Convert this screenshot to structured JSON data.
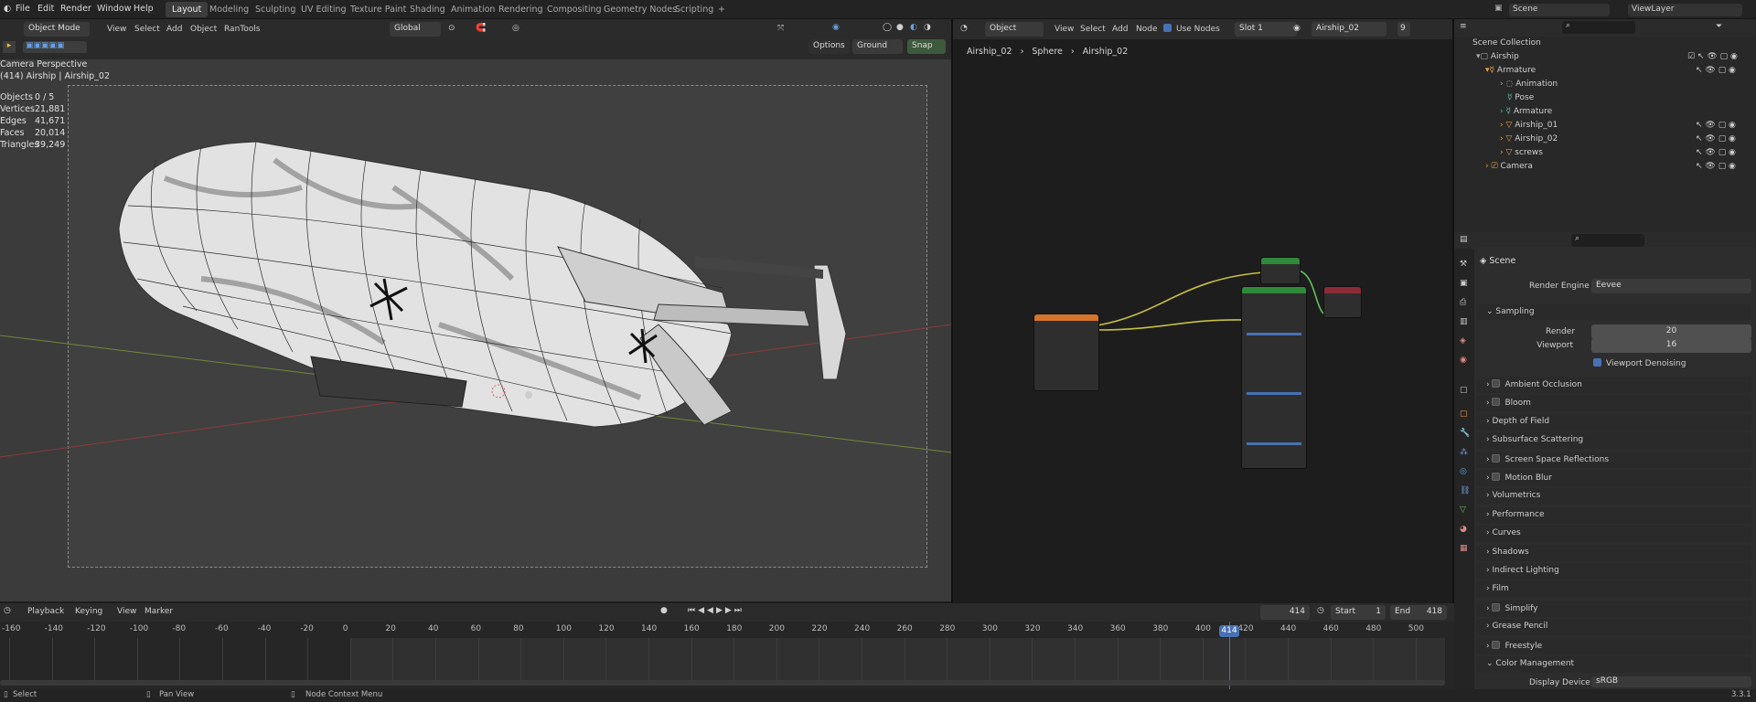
{
  "topbar": {
    "menus": [
      "File",
      "Edit",
      "Render",
      "Window",
      "Help"
    ],
    "workspaces": [
      "Layout",
      "Modeling",
      "Sculpting",
      "UV Editing",
      "Texture Paint",
      "Shading",
      "Animation",
      "Rendering",
      "Compositing",
      "Geometry Nodes",
      "Scripting"
    ],
    "active_workspace": "Layout",
    "add_tab": "+",
    "scene": "Scene",
    "view_layer": "ViewLayer"
  },
  "viewport_header": {
    "mode": "Object Mode",
    "menus": [
      "View",
      "Select",
      "Add",
      "Object",
      "RanTools"
    ],
    "orientation": "Global",
    "options": "Options",
    "ground": "Ground",
    "snap": "Snap"
  },
  "viewport": {
    "camera_label": "Camera Perspective",
    "object_label": "(414) Airship | Airship_02",
    "stats": [
      {
        "k": "Objects",
        "v": "0 / 5"
      },
      {
        "k": "Vertices",
        "v": "21,881"
      },
      {
        "k": "Edges",
        "v": "41,671"
      },
      {
        "k": "Faces",
        "v": "20,014"
      },
      {
        "k": "Triangles",
        "v": "39,249"
      }
    ]
  },
  "node_editor": {
    "type": "Object",
    "menus": [
      "View",
      "Select",
      "Add",
      "Node"
    ],
    "use_nodes": "Use Nodes",
    "slot": "Slot 1",
    "material": "Airship_02",
    "users": "9",
    "breadcrumb": [
      "Airship_02",
      "Sphere",
      "Airship_02"
    ]
  },
  "outliner": {
    "root": "Scene Collection",
    "items": [
      {
        "label": "Airship",
        "indent": 0
      },
      {
        "label": "Armature",
        "indent": 1
      },
      {
        "label": "Animation",
        "indent": 2
      },
      {
        "label": "Pose",
        "indent": 2
      },
      {
        "label": "Armature",
        "indent": 2
      },
      {
        "label": "Airship_01",
        "indent": 2
      },
      {
        "label": "Airship_02",
        "indent": 2
      },
      {
        "label": "screws",
        "indent": 2
      },
      {
        "label": "Camera",
        "indent": 1
      }
    ]
  },
  "properties": {
    "title": "Scene",
    "render_engine_label": "Render Engine",
    "render_engine": "Eevee",
    "sampling": "Sampling",
    "render_label": "Render",
    "render_value": "20",
    "viewport_label": "Viewport",
    "viewport_value": "16",
    "denoise": "Viewport Denoising",
    "panels": [
      "Ambient Occlusion",
      "Bloom",
      "Depth of Field",
      "Subsurface Scattering",
      "Screen Space Reflections",
      "Motion Blur",
      "Volumetrics",
      "Performance",
      "Curves",
      "Shadows",
      "Indirect Lighting",
      "Film",
      "Simplify",
      "Grease Pencil",
      "Freestyle",
      "Color Management"
    ],
    "display_device_label": "Display Device",
    "display_device": "sRGB"
  },
  "timeline": {
    "menus": [
      "Playback",
      "Keying",
      "View",
      "Marker"
    ],
    "current_frame": "414",
    "start_label": "Start",
    "start": "1",
    "end_label": "End",
    "end": "418",
    "ticks": [
      "-160",
      "-140",
      "-120",
      "-100",
      "-80",
      "-60",
      "-40",
      "-20",
      "0",
      "20",
      "40",
      "60",
      "80",
      "100",
      "120",
      "140",
      "160",
      "180",
      "200",
      "220",
      "240",
      "260",
      "280",
      "300",
      "320",
      "340",
      "360",
      "380",
      "400",
      "420",
      "440",
      "460",
      "480",
      "500"
    ],
    "frame_marker": "414"
  },
  "status": {
    "select": "Select",
    "pan": "Pan View",
    "context": "Node Context Menu",
    "version": "3.3.1"
  },
  "colors": {
    "accent": "#4772b3",
    "header": "#2b2b2b",
    "node_tex": "#d5752b",
    "node_green": "#2f8a3a",
    "node_red": "#8c2b37"
  }
}
